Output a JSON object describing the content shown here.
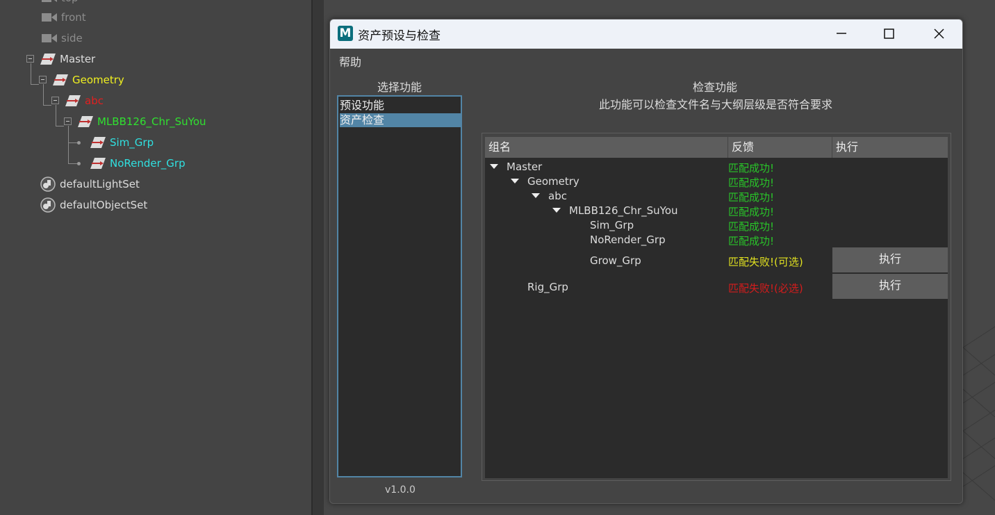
{
  "outliner": {
    "items": [
      {
        "label": "top",
        "color": "#8c8c8c"
      },
      {
        "label": "front",
        "color": "#8c8c8c"
      },
      {
        "label": "side",
        "color": "#8c8c8c"
      },
      {
        "label": "Master",
        "color": "#dddddd"
      },
      {
        "label": "Geometry",
        "color": "#f0f020"
      },
      {
        "label": "abc",
        "color": "#e02020"
      },
      {
        "label": "MLBB126_Chr_SuYou",
        "color": "#30e030"
      },
      {
        "label": "Sim_Grp",
        "color": "#30e0e0"
      },
      {
        "label": "NoRender_Grp",
        "color": "#30e0e0"
      },
      {
        "label": "defaultLightSet",
        "color": "#dddddd"
      },
      {
        "label": "defaultObjectSet",
        "color": "#dddddd"
      }
    ]
  },
  "dialog": {
    "title": "资产预设与检查",
    "app_icon_letter": "M",
    "menu": [
      "帮助"
    ],
    "select_title": "选择功能",
    "functions": [
      "预设功能",
      "资产检查"
    ],
    "selected_function": "资产检查",
    "version": "v1.0.0",
    "check_title": "检查功能",
    "check_desc": "此功能可以检查文件名与大纲层级是否符合要求",
    "table": {
      "headers": [
        "组名",
        "反馈",
        "执行"
      ],
      "rows": [
        {
          "name": "Master",
          "feedback": "匹配成功!",
          "status": "success",
          "level": 0,
          "expanded": true
        },
        {
          "name": "Geometry",
          "feedback": "匹配成功!",
          "status": "success",
          "level": 1,
          "expanded": true
        },
        {
          "name": "abc",
          "feedback": "匹配成功!",
          "status": "success",
          "level": 2,
          "expanded": true
        },
        {
          "name": "MLBB126_Chr_SuYou",
          "feedback": "匹配成功!",
          "status": "success",
          "level": 3,
          "expanded": true
        },
        {
          "name": "Sim_Grp",
          "feedback": "匹配成功!",
          "status": "success",
          "level": 4
        },
        {
          "name": "NoRender_Grp",
          "feedback": "匹配成功!",
          "status": "success",
          "level": 4
        },
        {
          "name": "Grow_Grp",
          "feedback": "匹配失败!(可选)",
          "status": "optional",
          "level": 4,
          "action": "执行"
        },
        {
          "name": "Rig_Grp",
          "feedback": "匹配失败!(必选)",
          "status": "required",
          "level": 1,
          "action": "执行"
        }
      ]
    },
    "status_colors": {
      "success": "#29c429",
      "optional": "#e0e020",
      "required": "#d41c1c"
    }
  }
}
